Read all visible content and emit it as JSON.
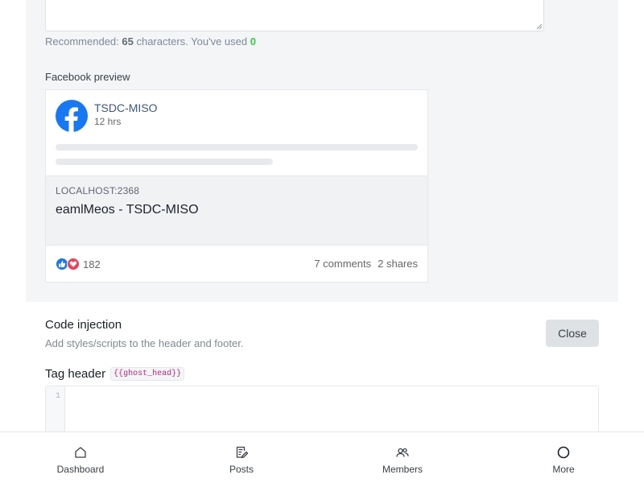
{
  "excerpt": {
    "recommended_prefix": "Recommended: ",
    "recommended_count": "65",
    "recommended_mid": " characters. You've used ",
    "used_count": "0"
  },
  "facebook_preview": {
    "label": "Facebook preview",
    "site_name": "TSDC-MISO",
    "time": "12 hrs",
    "domain": "LOCALHOST:2368",
    "title": "eamlMeos - TSDC-MISO",
    "reaction_count": "182",
    "comments": "7 comments",
    "shares": "2 shares",
    "icons": [
      "facebook-logo",
      "like-icon",
      "love-icon"
    ],
    "brand_color": "#1877f2"
  },
  "code_injection": {
    "title": "Code injection",
    "description": "Add styles/scripts to the header and footer.",
    "close_label": "Close",
    "tag_header_label": "Tag header",
    "tag_header_code": "{{ghost_head}}",
    "line_number": "1"
  },
  "bottom_nav": {
    "items": [
      {
        "label": "Dashboard",
        "icon": "home-icon"
      },
      {
        "label": "Posts",
        "icon": "posts-icon"
      },
      {
        "label": "Members",
        "icon": "members-icon"
      },
      {
        "label": "More",
        "icon": "more-icon"
      }
    ]
  }
}
